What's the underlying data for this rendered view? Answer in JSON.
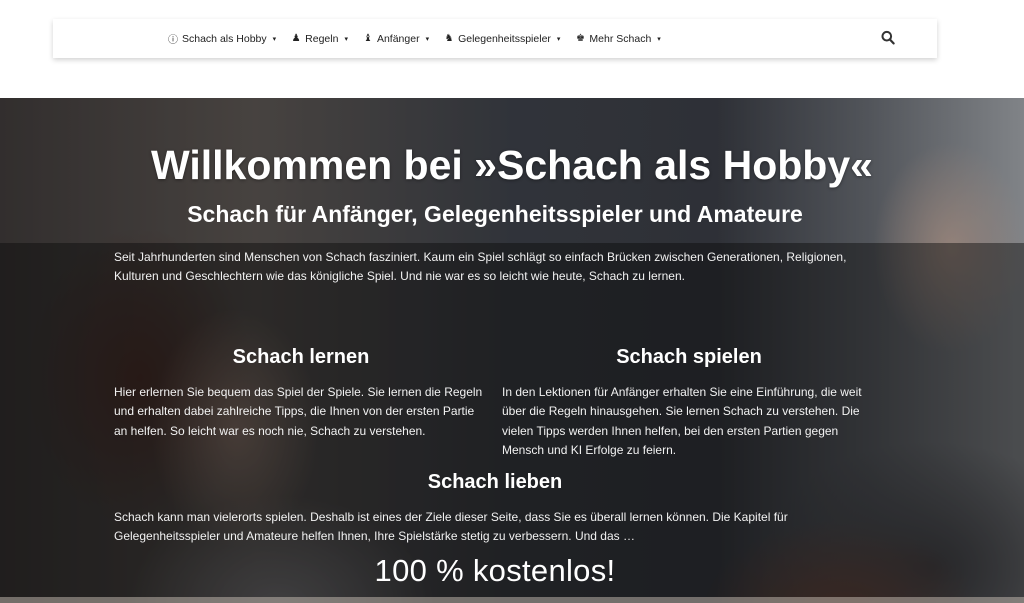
{
  "nav": {
    "items": [
      {
        "label": "Schach als Hobby",
        "icon": "info-circle-icon",
        "glyph": "ⓘ"
      },
      {
        "label": "Regeln",
        "icon": "pawn-icon",
        "glyph": "♟"
      },
      {
        "label": "Anfänger",
        "icon": "bishop-icon",
        "glyph": "♝"
      },
      {
        "label": "Gelegenheitsspieler",
        "icon": "knight-icon",
        "glyph": "♞"
      },
      {
        "label": "Mehr Schach",
        "icon": "king-icon",
        "glyph": "♚"
      }
    ],
    "caret": "▾",
    "search_icon": "search-icon"
  },
  "hero": {
    "title": "Willkommen bei »Schach als Hobby«",
    "subtitle": "Schach für Anfänger, Gelegenheitsspieler und Amateure",
    "intro": "Seit Jahrhunderten sind Menschen von Schach fasziniert. Kaum ein Spiel schlägt so einfach Brücken zwischen Generationen, Religionen, Kulturen und Geschlechtern wie das königliche Spiel. Und nie war es so leicht wie heute, Schach zu lernen.",
    "learn": {
      "title": "Schach lernen",
      "text": "Hier erlernen Sie bequem das Spiel der Spiele. Sie lernen die Regeln und erhalten dabei zahlreiche Tipps, die Ihnen von der ersten Partie an helfen. So leicht war es noch nie, Schach zu verstehen."
    },
    "play": {
      "title": "Schach spielen",
      "text": "In den Lektionen für Anfänger erhalten Sie eine Einführung, die weit über die Regeln hinausgehen. Sie lernen Schach zu verstehen. Die vielen Tipps werden Ihnen helfen, bei den ersten Partien gegen Mensch und KI Erfolge zu feiern."
    },
    "love": {
      "title": "Schach lieben",
      "text": "Schach kann man vielerorts spielen. Deshalb ist eines der Ziele dieser Seite, dass Sie es überall lernen können. Die Kapitel für Gelegenheitsspieler und Amateure helfen Ihnen, Ihre Spielstärke stetig zu verbessern. Und das …"
    },
    "cta": "100 % kostenlos!"
  }
}
